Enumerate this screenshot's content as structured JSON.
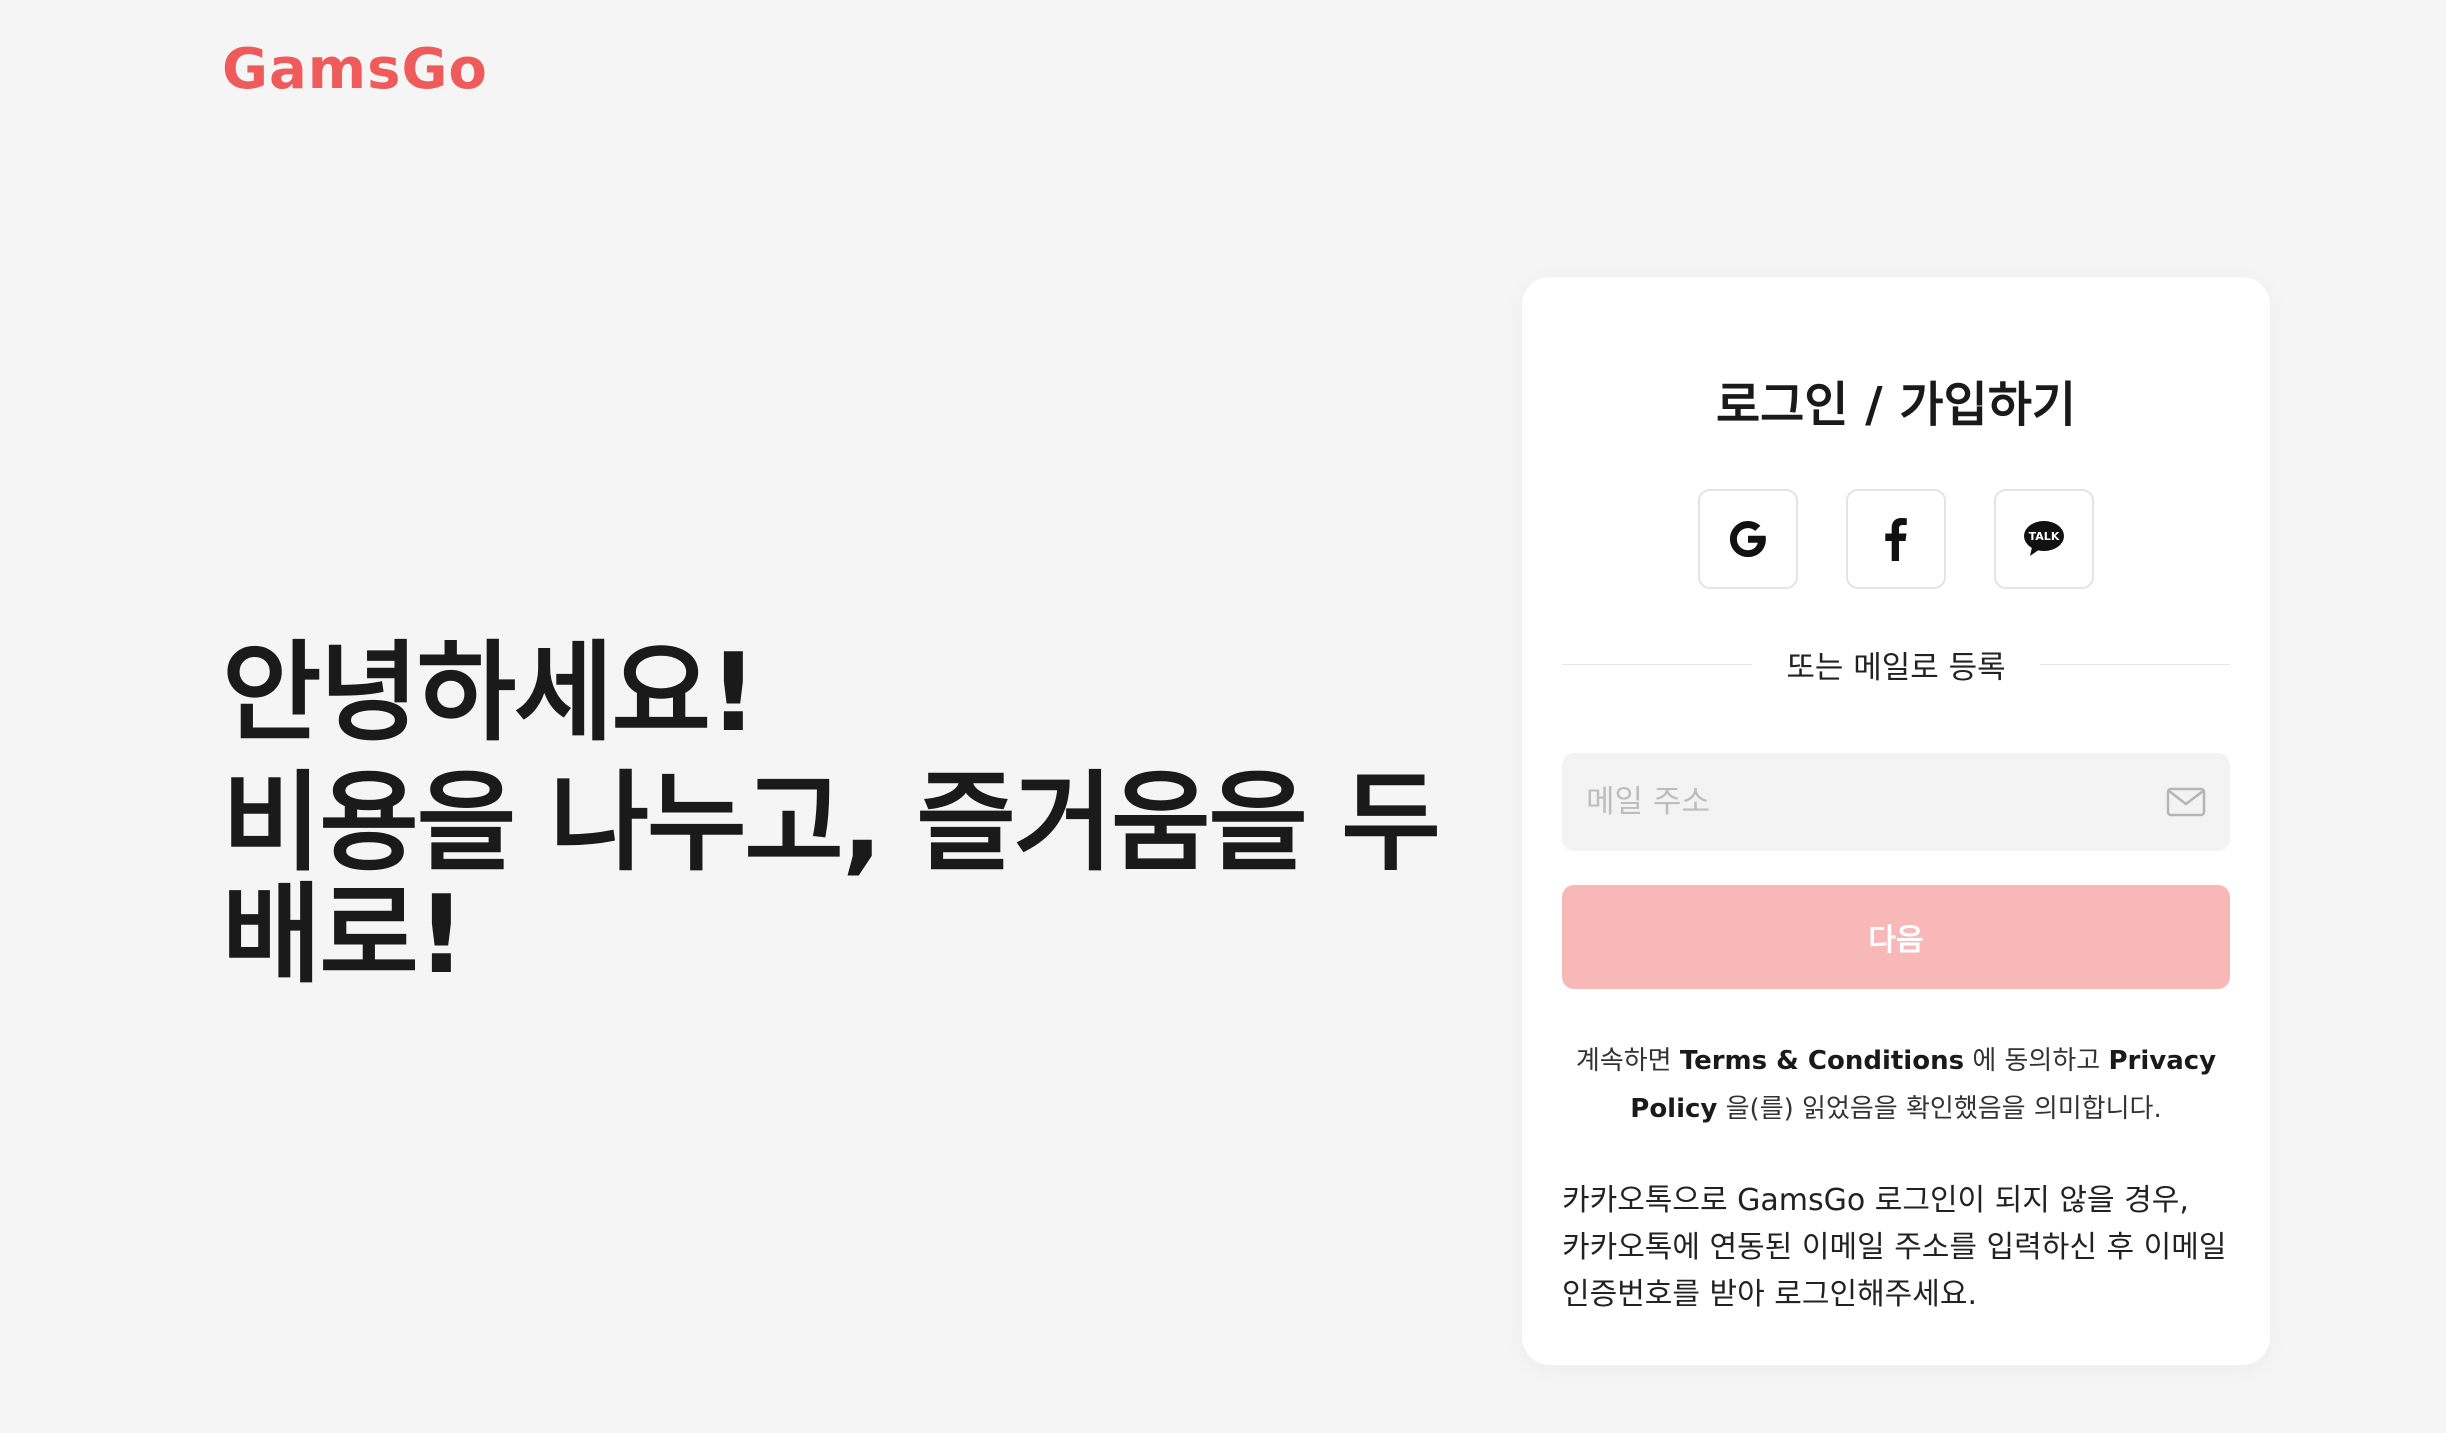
{
  "brand": {
    "logo_text": "GamsGo",
    "accent_color": "#ef5b5b"
  },
  "hero": {
    "greeting": "안녕하세요!",
    "tagline": "비용을 나누고, 즐거움을 두 배로!"
  },
  "login_card": {
    "title": "로그인 / 가입하기",
    "social_buttons": [
      {
        "provider": "Google",
        "icon": "google-icon"
      },
      {
        "provider": "Facebook",
        "icon": "facebook-icon"
      },
      {
        "provider": "KakaoTalk",
        "icon": "kakaotalk-icon",
        "icon_text": "TALK"
      }
    ],
    "divider_text": "또는 메일로 등록",
    "email": {
      "placeholder": "메일 주소",
      "value": "",
      "icon": "mail-icon"
    },
    "next_button": {
      "label": "다음",
      "color": "#f8b8b8"
    },
    "terms": {
      "prefix": "계속하면",
      "terms_link": "Terms & Conditions",
      "middle": "에 동의하고",
      "privacy_link": "Privacy Policy",
      "suffix": "을(를) 읽었음을 확인했음을 의미합니다."
    },
    "kakao_note": "카카오톡으로 GamsGo 로그인이 되지 않을 경우, 카카오톡에 연동된 이메일 주소를 입력하신 후 이메일 인증번호를 받아 로그인해주세요."
  }
}
